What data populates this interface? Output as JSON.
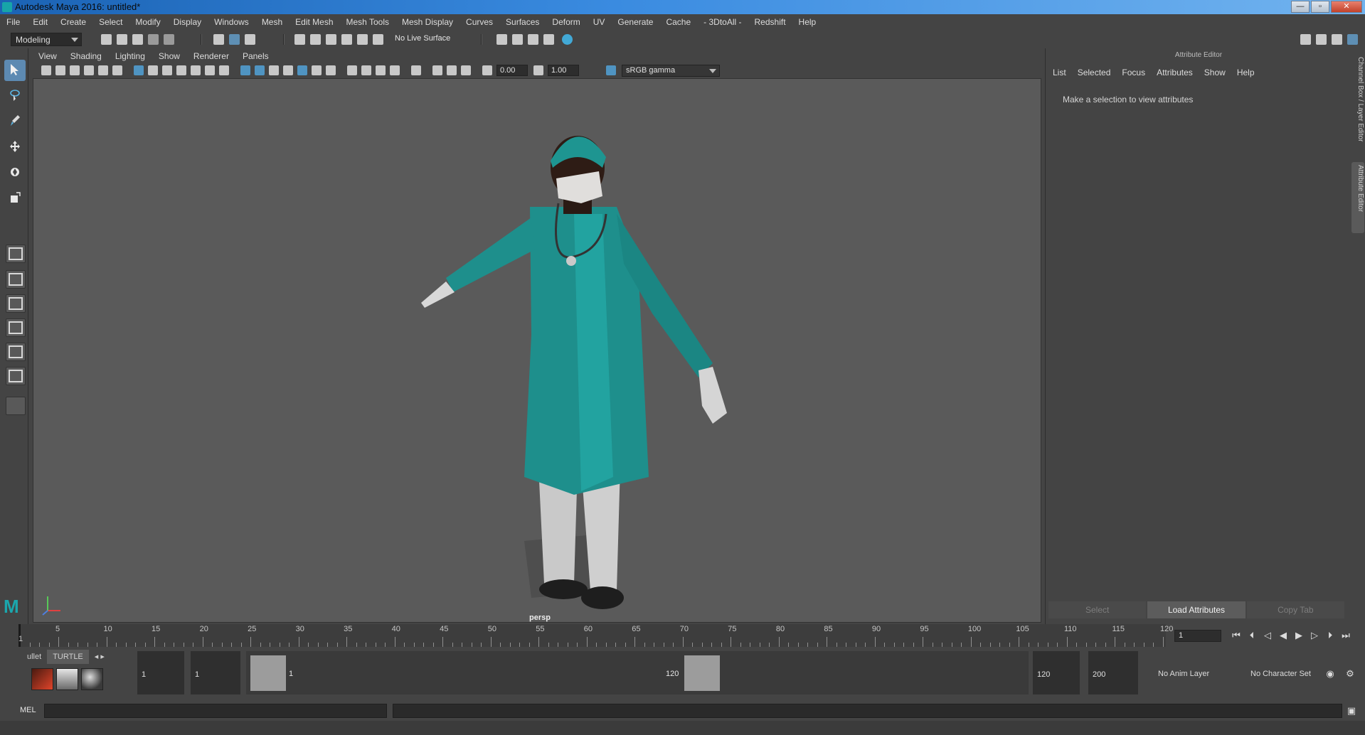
{
  "window": {
    "title": "Autodesk Maya 2016: untitled*",
    "minimize": "—",
    "maximize": "▫",
    "close": "✕"
  },
  "menubar": [
    "File",
    "Edit",
    "Create",
    "Select",
    "Modify",
    "Display",
    "Windows",
    "Mesh",
    "Edit Mesh",
    "Mesh Tools",
    "Mesh Display",
    "Curves",
    "Surfaces",
    "Deform",
    "UV",
    "Generate",
    "Cache",
    "- 3DtoAll -",
    "Redshift",
    "Help"
  ],
  "status": {
    "mode": "Modeling",
    "live_surface": "No Live Surface"
  },
  "viewport": {
    "menu": [
      "View",
      "Shading",
      "Lighting",
      "Show",
      "Renderer",
      "Panels"
    ],
    "exposure": "0.00",
    "gamma": "1.00",
    "color_space": "sRGB gamma",
    "camera": "persp"
  },
  "attribute_editor": {
    "title": "Attribute Editor",
    "menu": [
      "List",
      "Selected",
      "Focus",
      "Attributes",
      "Show",
      "Help"
    ],
    "message": "Make a selection to view attributes",
    "buttons": {
      "select": "Select",
      "load": "Load Attributes",
      "copy": "Copy Tab"
    }
  },
  "side_tabs": {
    "channel_box": "Channel Box / Layer Editor",
    "attribute_editor": "Attribute Editor"
  },
  "timeline": {
    "ticks": [
      "5",
      "10",
      "15",
      "20",
      "25",
      "30",
      "35",
      "40",
      "45",
      "50",
      "55",
      "60",
      "65",
      "70",
      "75",
      "80",
      "85",
      "90",
      "95",
      "100",
      "105",
      "110",
      "115",
      "120"
    ],
    "current_label": "1",
    "current_frame": "1"
  },
  "shelf": {
    "tabs": [
      "ullet",
      "TURTLE"
    ]
  },
  "range": {
    "start": "1",
    "playback_start": "1",
    "handle_start": "1",
    "handle_end": "120",
    "playback_end": "120",
    "end": "200",
    "anim_layer": "No Anim Layer",
    "character_set": "No Character Set"
  },
  "command": {
    "label": "MEL"
  },
  "colors": {
    "accent": "#5d8ab2",
    "scrub_teal": "#1ba7ad",
    "viewport_bg": "#5a5a5a"
  }
}
